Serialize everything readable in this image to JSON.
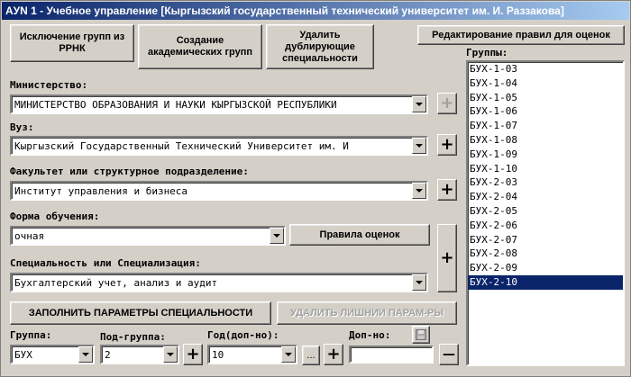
{
  "window": {
    "title": "AУN 1 - Учебное управление [Кыргызский государственный технический университет им. И. Раззакова]"
  },
  "toolbar": {
    "exclude_groups": "Исключение групп из РРНК",
    "create_groups": "Создание академических групп",
    "remove_duplicates": "Удалить дублирующие специальности",
    "edit_rules": "Редактирование правил для оценок"
  },
  "ministry": {
    "label": "Министерство:",
    "value": "МИНИСТЕРСТВО ОБРАЗОВАНИЯ И НАУКИ КЫРГЫЗСКОЙ РЕСПУБЛИКИ"
  },
  "university": {
    "label": "Вуз:",
    "value": "Кыргызский Государственный Технический Университет им. И"
  },
  "faculty": {
    "label": "Факультет или структурное подразделение:",
    "value": "Институт управления и бизнеса"
  },
  "study_form": {
    "label": "Форма обучения:",
    "value": "очная",
    "rules_button": "Правила оценок"
  },
  "specialty": {
    "label": "Специальность или Специализация:",
    "value": "Бухгалтерский учет, анализ и аудит"
  },
  "actions": {
    "fill_params": "ЗАПОЛНИТЬ ПАРАМЕТРЫ СПЕЦИАЛЬНОСТИ",
    "delete_extra": "УДАЛИТЬ ЛИШНИИ ПАРАМ-РЫ"
  },
  "bottom": {
    "group_label": "Группа:",
    "group_value": "БУХ",
    "subgroup_label": "Под-группа:",
    "subgroup_value": "2",
    "year_label": "Год(доп-но):",
    "year_value": "10",
    "extra_label": "Доп-но:",
    "extra_value": "",
    "ellipsis": "...",
    "plus": "+",
    "minus": "—"
  },
  "groups": {
    "label": "Группы:",
    "items": [
      "БУХ-1-03",
      "БУХ-1-04",
      "БУХ-1-05",
      "БУХ-1-06",
      "БУХ-1-07",
      "БУХ-1-08",
      "БУХ-1-09",
      "БУХ-1-10",
      "БУХ-2-03",
      "БУХ-2-04",
      "БУХ-2-05",
      "БУХ-2-06",
      "БУХ-2-07",
      "БУХ-2-08",
      "БУХ-2-09",
      "БУХ-2-10"
    ],
    "selected": "БУХ-2-10"
  }
}
